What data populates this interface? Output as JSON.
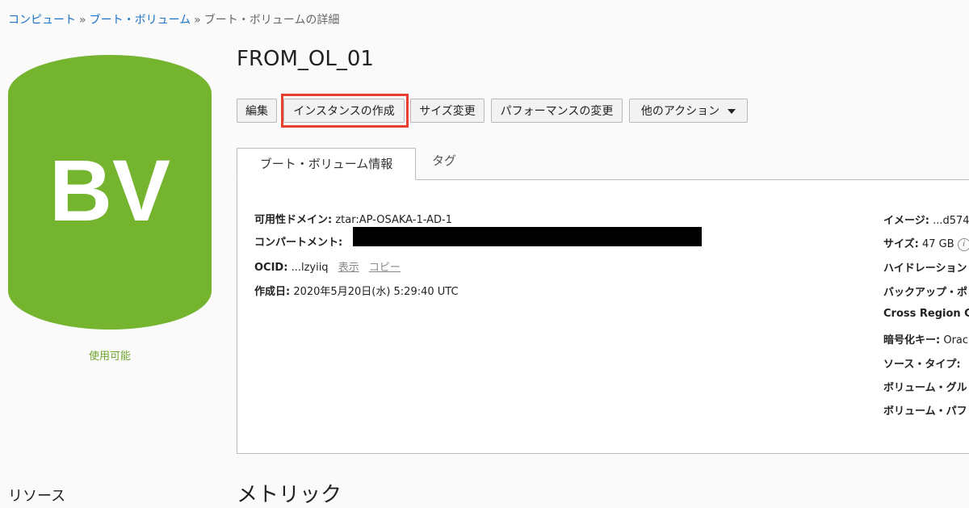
{
  "breadcrumb": {
    "items": [
      "コンピュート",
      "ブート・ボリューム"
    ],
    "separator": "»",
    "current": "ブート・ボリュームの詳細"
  },
  "volume": {
    "icon_text": "BV",
    "icon_color": "#74b42f",
    "status": "使用可能",
    "title": "FROM_OL_01"
  },
  "toolbar": {
    "edit": "編集",
    "create_instance": "インスタンスの作成",
    "resize": "サイズ変更",
    "change_performance": "パフォーマンスの変更",
    "more_actions": "他のアクション",
    "highlight_color": "#e8402f"
  },
  "tabs": {
    "info": "ブート・ボリューム情報",
    "tags": "タグ"
  },
  "details_left": {
    "availability_domain_label": "可用性ドメイン:",
    "availability_domain_value": "ztar:AP-OSAKA-1-AD-1",
    "compartment_label": "コンパートメント:",
    "compartment_value": "",
    "ocid_label": "OCID:",
    "ocid_value": "...lzyiiq",
    "ocid_show": "表示",
    "ocid_copy": "コピー",
    "created_label": "作成日:",
    "created_value": "2020年5月20日(水) 5:29:40 UTC"
  },
  "details_right": {
    "image_label": "イメージ:",
    "image_value": "...d574",
    "size_label": "サイズ:",
    "size_value": "47 GB",
    "hydration_label": "ハイドレーション",
    "backup_label": "バックアップ・ポ",
    "cross_region_label": "Cross Region C",
    "encryption_label": "暗号化キー:",
    "encryption_value": "Orac",
    "source_type_label": "ソース・タイプ:",
    "volume_group_label": "ボリューム・グル",
    "volume_perf_label": "ボリューム・パフ"
  },
  "sections": {
    "resources": "リソース",
    "metrics": "メトリック"
  }
}
